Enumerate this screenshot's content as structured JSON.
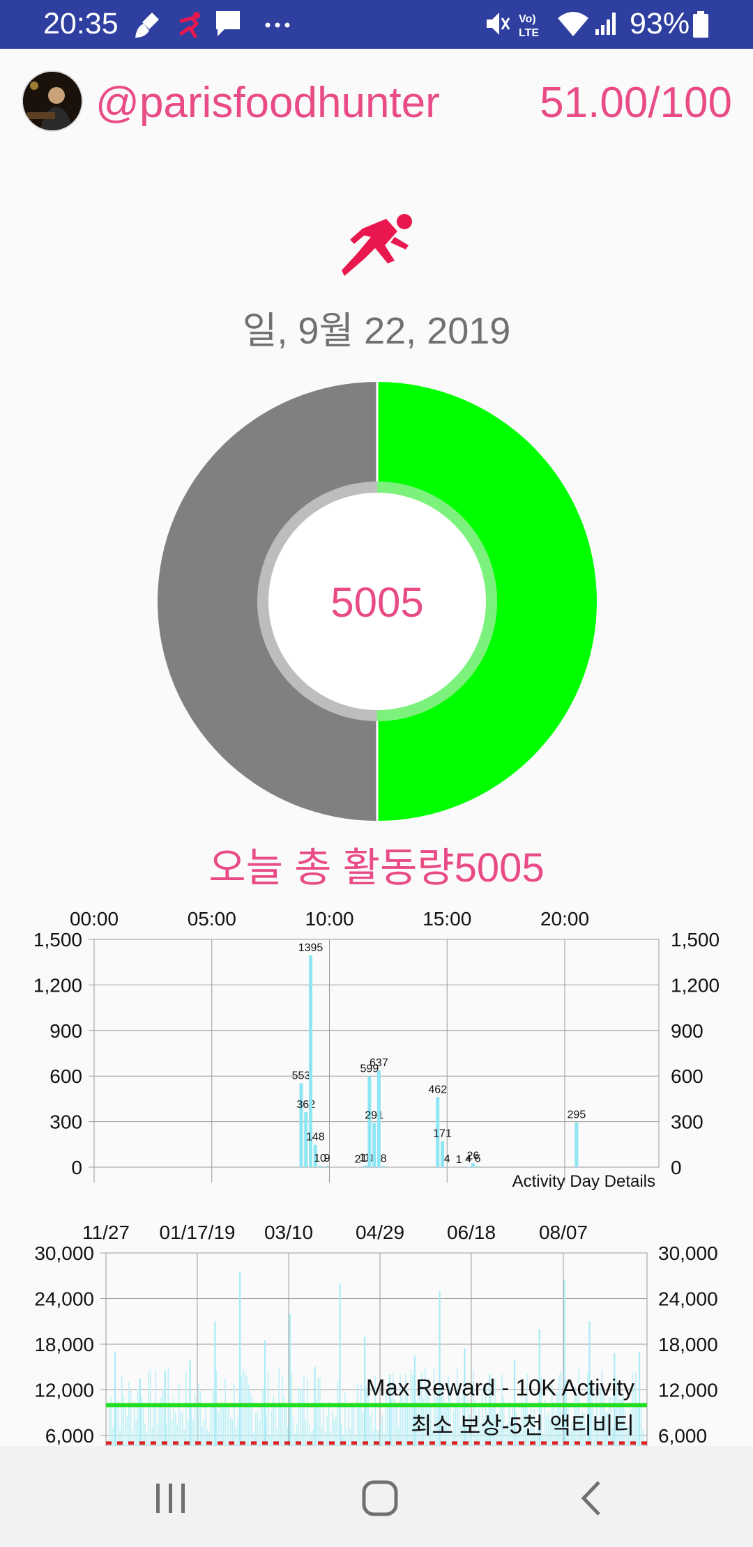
{
  "status_bar": {
    "time": "20:35",
    "battery": "93%",
    "icons": [
      "cleaner-icon",
      "runner-icon",
      "message-icon",
      "more-icon",
      "mute-icon",
      "volte-icon",
      "wifi-icon",
      "signal-icon",
      "battery-icon"
    ]
  },
  "header": {
    "username": "@parisfoodhunter",
    "score": "51.00/100"
  },
  "date": "일, 9월 22, 2019",
  "donut": {
    "center_value": "5005",
    "progress": 0.5005,
    "colors": {
      "progress": "#00ff00",
      "remaining": "#808080"
    }
  },
  "total_label": "오늘 총 활동량5005",
  "chart_data": [
    {
      "type": "bar",
      "title": "Activity Day Details",
      "x_tick_labels": [
        "00:00",
        "05:00",
        "10:00",
        "15:00",
        "20:00"
      ],
      "x_range_hours": [
        0,
        24
      ],
      "y_tick_labels": [
        "1,500",
        "1,200",
        "900",
        "600",
        "300",
        "0"
      ],
      "ylim": [
        0,
        1500
      ],
      "color": "#8ee5f3",
      "points": [
        {
          "hour": 8.8,
          "value": 553,
          "label": "553"
        },
        {
          "hour": 9.0,
          "value": 362,
          "label": "362"
        },
        {
          "hour": 9.2,
          "value": 1395,
          "label": "1395"
        },
        {
          "hour": 9.4,
          "value": 148,
          "label": "148"
        },
        {
          "hour": 9.6,
          "value": 10,
          "label": "10"
        },
        {
          "hour": 9.9,
          "value": 9,
          "label": "9"
        },
        {
          "hour": 11.2,
          "value": 2,
          "label": "2"
        },
        {
          "hour": 11.5,
          "value": 11,
          "label": "11"
        },
        {
          "hour": 11.6,
          "value": 10,
          "label": "10"
        },
        {
          "hour": 11.7,
          "value": 599,
          "label": "599"
        },
        {
          "hour": 11.9,
          "value": 291,
          "label": "291"
        },
        {
          "hour": 12.1,
          "value": 637,
          "label": "637"
        },
        {
          "hour": 12.3,
          "value": 8,
          "label": "8"
        },
        {
          "hour": 14.6,
          "value": 462,
          "label": "462"
        },
        {
          "hour": 14.8,
          "value": 171,
          "label": "171"
        },
        {
          "hour": 15.0,
          "value": 4,
          "label": "4"
        },
        {
          "hour": 15.5,
          "value": 1,
          "label": "1"
        },
        {
          "hour": 15.9,
          "value": 4,
          "label": "4"
        },
        {
          "hour": 16.1,
          "value": 26,
          "label": "26"
        },
        {
          "hour": 16.3,
          "value": 6,
          "label": "6"
        },
        {
          "hour": 20.5,
          "value": 295,
          "label": "295"
        }
      ]
    },
    {
      "type": "bar",
      "x_tick_labels": [
        "11/27",
        "01/17/19",
        "03/10",
        "04/29",
        "06/18",
        "08/07"
      ],
      "y_tick_labels": [
        "30,000",
        "24,000",
        "18,000",
        "12,000",
        "6,000"
      ],
      "ylim": [
        3000,
        30000
      ],
      "color": "#bff1f7",
      "reference_lines": [
        {
          "label": "Max Reward - 10K Activity",
          "value": 10000,
          "color": "#22dd22",
          "style": "solid"
        },
        {
          "label": "최소 보상-5천 액티비티",
          "value": 5000,
          "color": "#dd2222",
          "style": "dotted"
        }
      ],
      "peak_values": [
        17000,
        13500,
        14500,
        16000,
        21000,
        27500,
        18500,
        22000,
        15000,
        26000,
        19000,
        14000,
        16500,
        25000,
        17500,
        14000,
        16000,
        20000,
        26500,
        21000,
        16800,
        17000
      ]
    }
  ],
  "nav_bar": {
    "icons": [
      "recents-icon",
      "home-icon",
      "back-icon"
    ]
  }
}
